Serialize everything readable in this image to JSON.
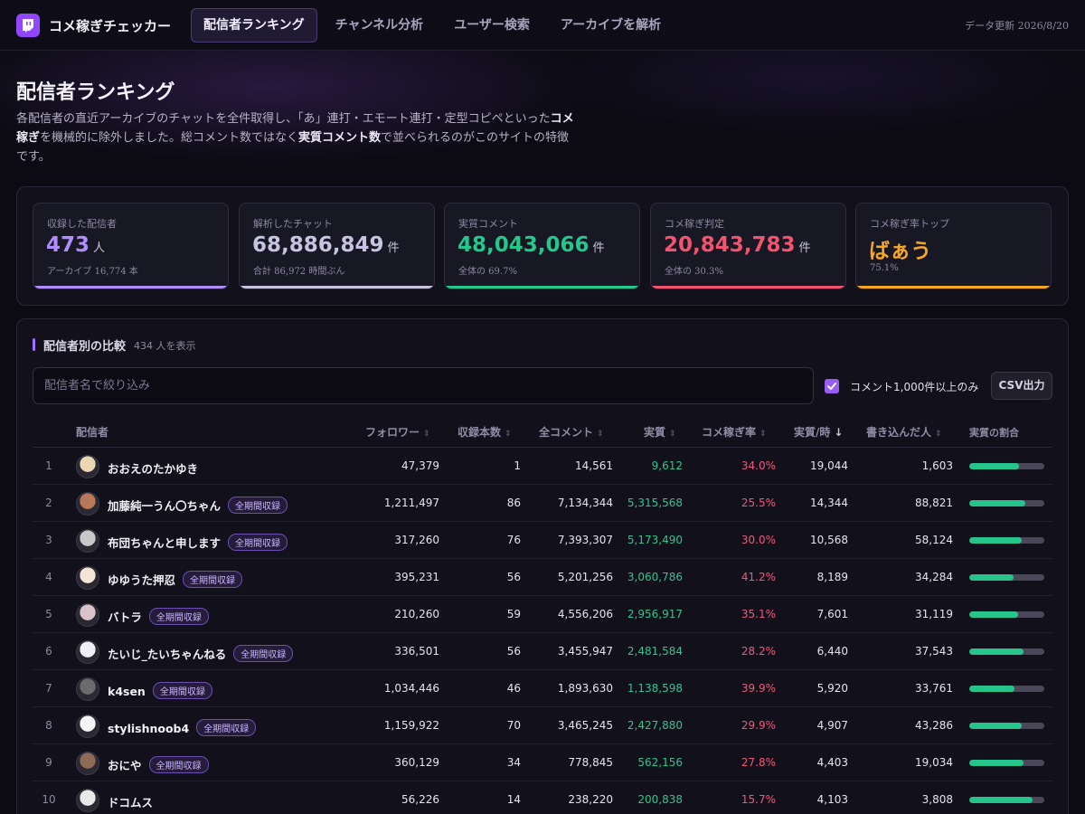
{
  "header": {
    "brand": "コメ稼ぎチェッカー",
    "nav": [
      {
        "label": "配信者ランキング",
        "active": true
      },
      {
        "label": "チャンネル分析",
        "active": false
      },
      {
        "label": "ユーザー検索",
        "active": false
      },
      {
        "label": "アーカイブを解析",
        "active": false
      }
    ],
    "updated": "データ更新 2026/8/20"
  },
  "page": {
    "title": "配信者ランキング",
    "desc_1": "各配信者の直近アーカイブのチャットを全件取得し、「あ」連打・エモート連打・定型コピペといった",
    "desc_b1": "コメ稼ぎ",
    "desc_2": "を機械的に除外しました。総コメント数ではなく",
    "desc_b2": "実質コメント数",
    "desc_3": "で並べられるのがこのサイトの特徴です。"
  },
  "stats": [
    {
      "label": "収録した配信者",
      "value": "473",
      "unit": "人",
      "sub": "アーカイブ 16,774 本",
      "color": "#b18cff"
    },
    {
      "label": "解析したチャット",
      "value": "68,886,849",
      "unit": "件",
      "sub": "合計 86,972 時間ぶん",
      "color": "#c7c3e0"
    },
    {
      "label": "実質コメント",
      "value": "48,043,066",
      "unit": "件",
      "sub": "全体の 69.7%",
      "color": "#22c98b"
    },
    {
      "label": "コメ稼ぎ判定",
      "value": "20,843,783",
      "unit": "件",
      "sub": "全体の 30.3%",
      "color": "#f2536f"
    },
    {
      "label": "コメ稼ぎ率トップ",
      "value": "ばぁう",
      "unit": "",
      "sub": "75.1%",
      "color": "#f5a623"
    }
  ],
  "compare": {
    "title": "配信者別の比較",
    "count": "434 人を表示",
    "filter_placeholder": "配信者名で絞り込み",
    "checkbox_label": "コメント1,000件以上のみ",
    "csv_label": "CSV出力",
    "columns": {
      "streamer": "配信者",
      "followers": "フォロワー",
      "archives": "収録本数",
      "all": "全コメント",
      "real": "実質",
      "rate": "コメ稼ぎ率",
      "per_hour": "実質/時",
      "people": "書き込んだ人",
      "ratio": "実質の割合"
    },
    "badge": "全期間収録",
    "rows": [
      {
        "rank": "1",
        "name": "おおえのたかゆき",
        "badge": false,
        "followers": "47,379",
        "archives": "1",
        "all": "14,561",
        "real": "9,612",
        "rate": "34.0%",
        "per_hour": "19,044",
        "people": "1,603",
        "ratio": 0.66,
        "avatar": "#e8d7b0"
      },
      {
        "rank": "2",
        "name": "加藤純一うん〇ちゃん",
        "badge": true,
        "followers": "1,211,497",
        "archives": "86",
        "all": "7,134,344",
        "real": "5,315,568",
        "rate": "25.5%",
        "per_hour": "14,344",
        "people": "88,821",
        "ratio": 0.745,
        "avatar": "#b9785a"
      },
      {
        "rank": "3",
        "name": "布団ちゃんと申します",
        "badge": true,
        "followers": "317,260",
        "archives": "76",
        "all": "7,393,307",
        "real": "5,173,490",
        "rate": "30.0%",
        "per_hour": "10,568",
        "people": "58,124",
        "ratio": 0.7,
        "avatar": "#c8c8c8"
      },
      {
        "rank": "4",
        "name": "ゆゆうた押忍",
        "badge": true,
        "followers": "395,231",
        "archives": "56",
        "all": "5,201,256",
        "real": "3,060,786",
        "rate": "41.2%",
        "per_hour": "8,189",
        "people": "34,284",
        "ratio": 0.588,
        "avatar": "#f3e6d8"
      },
      {
        "rank": "5",
        "name": "バトラ",
        "badge": true,
        "followers": "210,260",
        "archives": "59",
        "all": "4,556,206",
        "real": "2,956,917",
        "rate": "35.1%",
        "per_hour": "7,601",
        "people": "31,119",
        "ratio": 0.649,
        "avatar": "#d9c3c9"
      },
      {
        "rank": "6",
        "name": "たいじ_たいちゃんねる",
        "badge": true,
        "followers": "336,501",
        "archives": "56",
        "all": "3,455,947",
        "real": "2,481,584",
        "rate": "28.2%",
        "per_hour": "6,440",
        "people": "37,543",
        "ratio": 0.718,
        "avatar": "#eef0f6"
      },
      {
        "rank": "7",
        "name": "k4sen",
        "badge": true,
        "followers": "1,034,446",
        "archives": "46",
        "all": "1,893,630",
        "real": "1,138,598",
        "rate": "39.9%",
        "per_hour": "5,920",
        "people": "33,761",
        "ratio": 0.601,
        "avatar": "#6b6b6b"
      },
      {
        "rank": "8",
        "name": "stylishnoob4",
        "badge": true,
        "followers": "1,159,922",
        "archives": "70",
        "all": "3,465,245",
        "real": "2,427,880",
        "rate": "29.9%",
        "per_hour": "4,907",
        "people": "43,286",
        "ratio": 0.701,
        "avatar": "#f5f5f5"
      },
      {
        "rank": "9",
        "name": "おにや",
        "badge": true,
        "followers": "360,129",
        "archives": "34",
        "all": "778,845",
        "real": "562,156",
        "rate": "27.8%",
        "per_hour": "4,403",
        "people": "19,034",
        "ratio": 0.722,
        "avatar": "#8f6a57"
      },
      {
        "rank": "10",
        "name": "ドコムス",
        "badge": false,
        "followers": "56,226",
        "archives": "14",
        "all": "238,220",
        "real": "200,838",
        "rate": "15.7%",
        "per_hour": "4,103",
        "people": "3,808",
        "ratio": 0.843,
        "avatar": "#e9e9e9"
      }
    ]
  }
}
